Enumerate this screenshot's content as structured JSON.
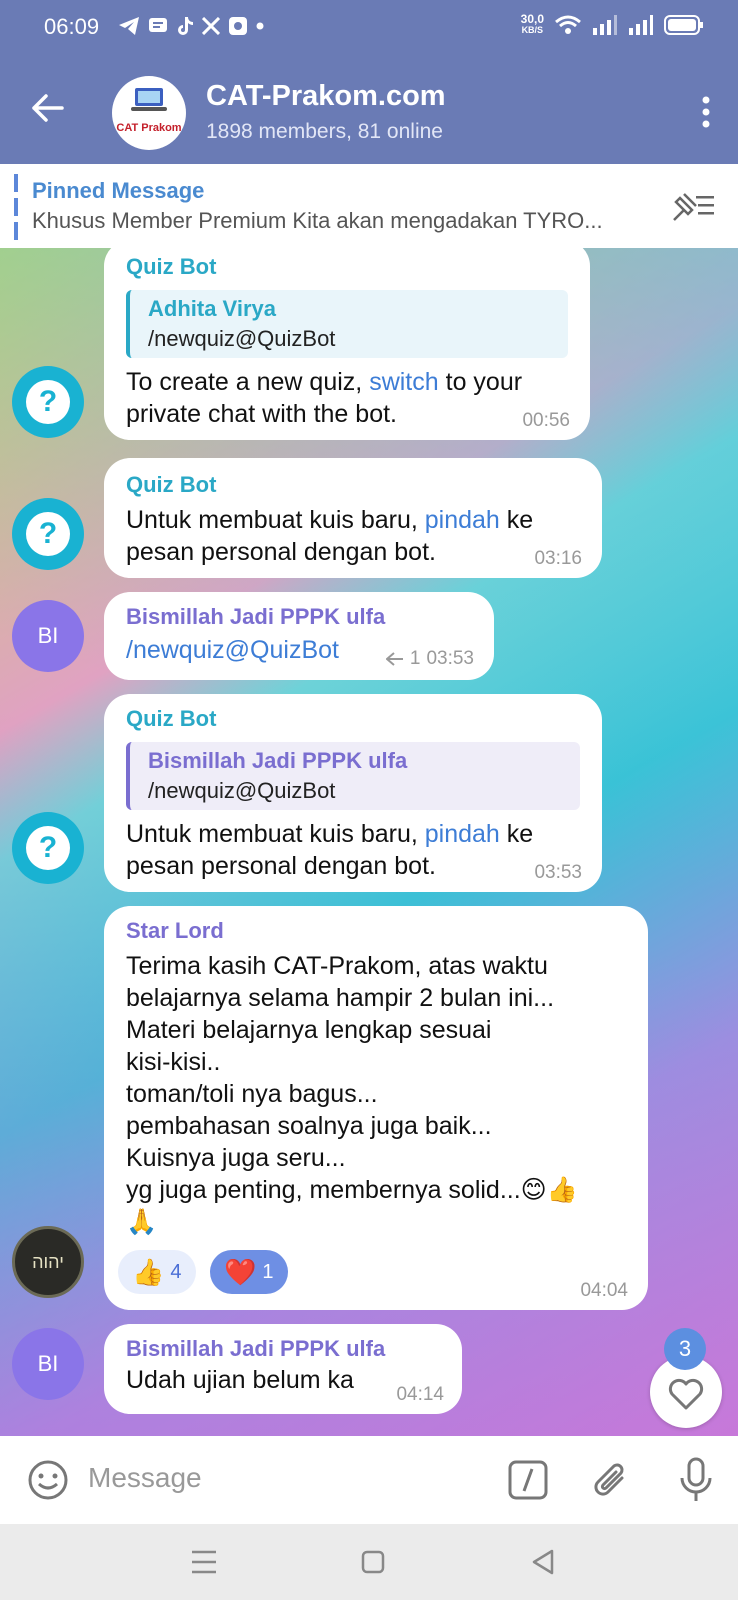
{
  "status_bar": {
    "time": "06:09",
    "speed": "30,0",
    "speed_unit": "KB/S"
  },
  "header": {
    "title": "CAT-Prakom.com",
    "subtitle": "1898 members, 81 online",
    "logo_text": "CAT Prakom"
  },
  "pinned": {
    "label": "Pinned Message",
    "text": "Khusus Member Premium Kita akan mengadakan TYRO..."
  },
  "messages": [
    {
      "sender": "Quiz Bot",
      "reply_name": "Adhita Virya",
      "reply_text": "/newquiz@QuizBot",
      "text_before": "To create a new quiz, ",
      "link": "switch",
      "text_after": " to your private chat with the bot.",
      "time": "00:56"
    },
    {
      "sender": "Quiz Bot",
      "text_before": "Untuk membuat kuis baru, ",
      "link": "pindah",
      "text_after": " ke pesan personal dengan bot.",
      "time": "03:16"
    },
    {
      "sender": "Bismillah Jadi PPPK ulfa",
      "link": "/newquiz@QuizBot",
      "reply_count": "1",
      "time": "03:53",
      "avatar": "BI"
    },
    {
      "sender": "Quiz Bot",
      "reply_name": "Bismillah Jadi PPPK ulfa",
      "reply_text": "/newquiz@QuizBot",
      "text_before": "Untuk membuat kuis baru, ",
      "link": "pindah",
      "text_after": " ke pesan personal dengan bot.",
      "time": "03:53"
    },
    {
      "sender": "Star Lord",
      "text": "Terima kasih CAT-Prakom, atas waktu\nbelajarnya selama hampir 2 bulan ini...\nMateri belajarnya lengkap sesuai\nkisi-kisi..\ntoman/toli nya bagus...\npembahasan soalnya juga baik...\nKuisnya juga seru...\nyg juga penting, membernya solid...😊👍\n🙏",
      "reactions": [
        {
          "emoji": "👍",
          "count": "4"
        },
        {
          "emoji": "❤️",
          "count": "1"
        }
      ],
      "time": "04:04",
      "avatar": "יהוה"
    },
    {
      "sender": "Bismillah Jadi PPPK ulfa",
      "text": "Udah ujian belum ka",
      "time": "04:14",
      "avatar": "BI"
    }
  ],
  "fab_badge": "3",
  "input": {
    "placeholder": "Message"
  },
  "colors": {
    "header": "#6a7bb5",
    "bot_name": "#2aa8c6",
    "user_name": "#7a6ed0",
    "link": "#3d7dd6"
  }
}
